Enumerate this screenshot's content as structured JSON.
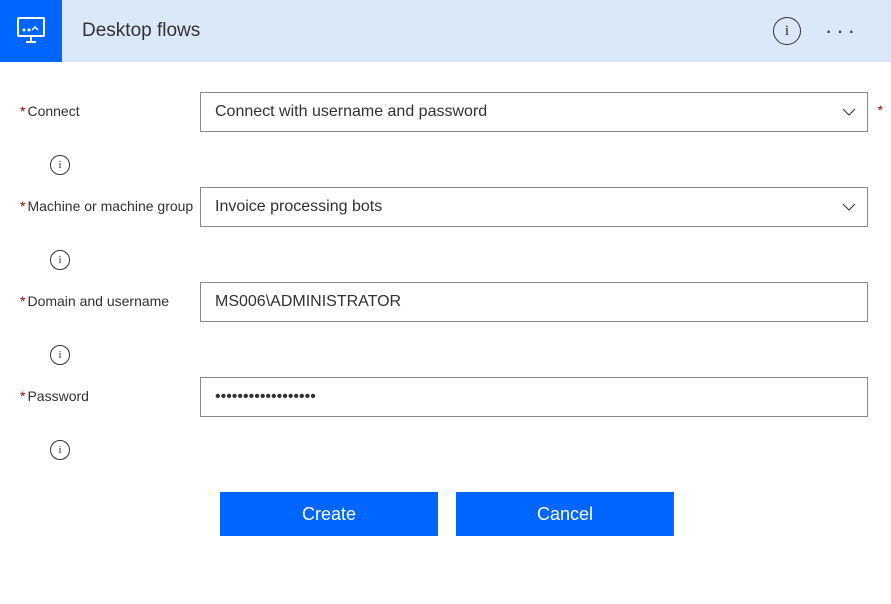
{
  "header": {
    "title": "Desktop flows"
  },
  "form": {
    "connect": {
      "label": "Connect",
      "value": "Connect with username and password"
    },
    "machine": {
      "label": "Machine or machine group",
      "value": "Invoice processing bots"
    },
    "domain": {
      "label": "Domain and username",
      "value": "MS006\\ADMINISTRATOR"
    },
    "password": {
      "label": "Password",
      "value": "••••••••••••••••••"
    }
  },
  "buttons": {
    "create": "Create",
    "cancel": "Cancel"
  }
}
